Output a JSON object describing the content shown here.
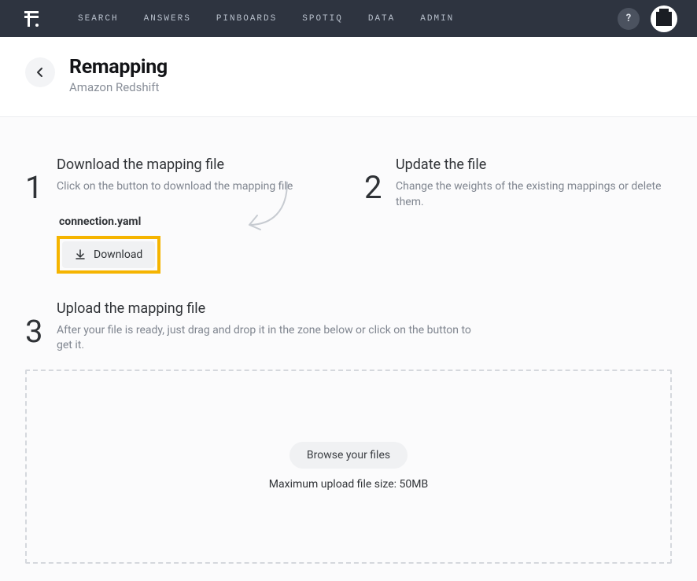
{
  "nav": {
    "items": [
      "SEARCH",
      "ANSWERS",
      "PINBOARDS",
      "SPOTIQ",
      "DATA",
      "ADMIN"
    ],
    "help_label": "?"
  },
  "header": {
    "title": "Remapping",
    "subtitle": "Amazon Redshift"
  },
  "steps": {
    "s1": {
      "num": "1",
      "title": "Download the mapping file",
      "desc": "Click on the button to download the mapping file",
      "filename": "connection.yaml",
      "button": "Download"
    },
    "s2": {
      "num": "2",
      "title": "Update the file",
      "desc": "Change the weights of the existing mappings or delete them."
    },
    "s3": {
      "num": "3",
      "title": "Upload the mapping file",
      "desc": "After your file is ready, just drag and drop it in the zone below or click on the button to get it."
    }
  },
  "dropzone": {
    "browse": "Browse your files",
    "hint": "Maximum upload file size: 50MB"
  }
}
